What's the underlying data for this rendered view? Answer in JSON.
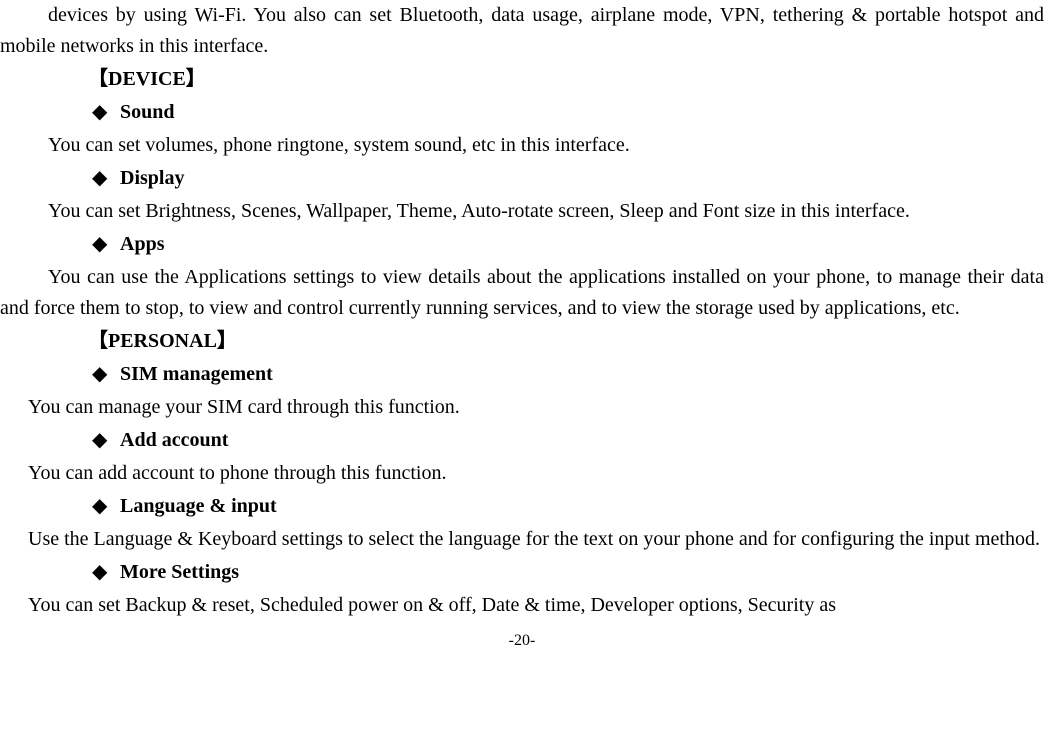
{
  "intro_fragment": "devices by using Wi-Fi. You also can set Bluetooth, data usage, airplane mode, VPN, tethering & portable hotspot and mobile networks in this interface.",
  "section_device": "【DEVICE】",
  "sound_title": "Sound",
  "sound_body": "You can set volumes, phone ringtone, system sound, etc in this interface.",
  "display_title": "Display",
  "display_body": "You can set Brightness, Scenes, Wallpaper, Theme, Auto-rotate screen, Sleep and Font size in this interface.",
  "apps_title": "Apps",
  "apps_body": "You can use the Applications settings to view details about the applications installed on your phone, to manage their data and force them to stop, to view and control currently running services, and to view the storage used by applications, etc.",
  "section_personal": "【PERSONAL】",
  "sim_title": "SIM management",
  "sim_body": "You can manage your SIM card through this function.",
  "add_account_title": "Add account",
  "add_account_body": "You can add account to phone through this function.",
  "lang_title": "Language & input",
  "lang_body": "Use the Language & Keyboard settings to select the language for the text on your phone and for configuring the input method.",
  "more_title": "More Settings",
  "more_body": "You can set Backup & reset, Scheduled power on & off, Date & time, Developer options, Security as",
  "page_number": "-20-"
}
